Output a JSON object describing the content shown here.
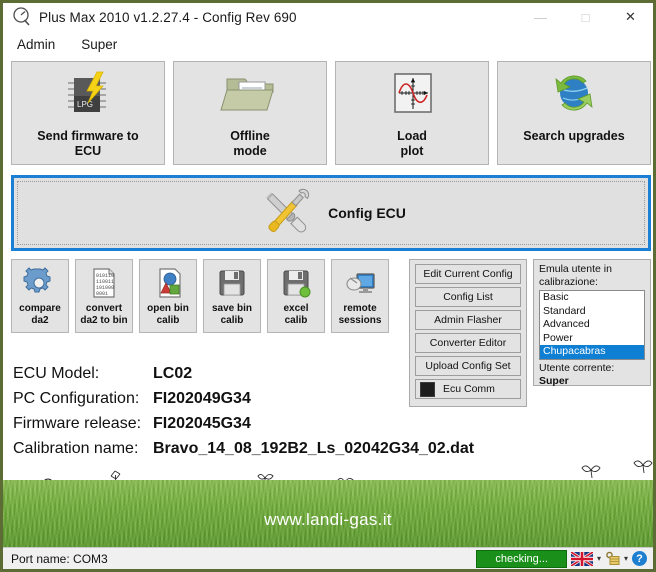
{
  "window": {
    "title": "Plus Max 2010 v1.2.27.4 - Config Rev 690",
    "app_icon": "gauge-icon",
    "minimize_label": "—",
    "maximize_label": "□",
    "close_label": "✕"
  },
  "menubar": {
    "items": [
      {
        "label": "Admin"
      },
      {
        "label": "Super"
      }
    ]
  },
  "top_buttons": [
    {
      "label": "Send firmware to ECU",
      "line1": "Send firmware to",
      "line2": "ECU",
      "icon": "lpg-chip-lightning-icon",
      "chip_text": "LPG"
    },
    {
      "label": "Offline mode",
      "line1": "Offline",
      "line2": "mode",
      "icon": "folder-document-icon"
    },
    {
      "label": "Load plot",
      "line1": "Load",
      "line2": "plot",
      "icon": "plot-graph-icon"
    },
    {
      "label": "Search upgrades",
      "line1": "Search upgrades",
      "line2": "",
      "icon": "globe-refresh-icon"
    }
  ],
  "config_banner": {
    "label": "Config ECU",
    "icon": "wrench-screwdriver-icon",
    "border_color": "#1b7fd4"
  },
  "small_buttons": [
    {
      "line1": "compare",
      "line2": "da2",
      "icon": "gear-icon"
    },
    {
      "line1": "convert",
      "line2": "da2 to bin",
      "icon": "binary-document-icon"
    },
    {
      "line1": "open bin",
      "line2": "calib",
      "icon": "shapes-document-icon"
    },
    {
      "line1": "save bin",
      "line2": "calib",
      "icon": "floppy-disk-icon"
    },
    {
      "line1": "excel",
      "line2": "calib",
      "icon": "floppy-disk-green-dot-icon"
    },
    {
      "line1": "remote",
      "line2": "sessions",
      "icon": "remote-monitor-icon"
    }
  ],
  "mid_buttons": [
    {
      "label": "Edit Current Config",
      "led": false
    },
    {
      "label": "Config List",
      "led": false
    },
    {
      "label": "Admin Flasher",
      "led": false
    },
    {
      "label": "Converter Editor",
      "led": false
    },
    {
      "label": "Upload Config Set",
      "led": false
    },
    {
      "label": "Ecu Comm",
      "led": true
    }
  ],
  "emulate_panel": {
    "title_line1": "Emula utente in",
    "title_line2": "calibrazione:",
    "options": [
      "Basic",
      "Standard",
      "Advanced",
      "Power",
      "Chupacabras"
    ],
    "selected": "Chupacabras",
    "selection_color": "#0f7fd4",
    "current_user_label": "Utente corrente:",
    "current_user": "Super"
  },
  "info": {
    "rows": [
      {
        "label": "ECU Model:",
        "value": "LC02"
      },
      {
        "label": "PC Configuration:",
        "value": "FI202049G34"
      },
      {
        "label": "Firmware release:",
        "value": "FI202045G34"
      },
      {
        "label": "Calibration name:",
        "value": "Bravo_14_08_192B2_Ls_02042G34_02.dat"
      }
    ]
  },
  "footer": {
    "site": "www.landi-gas.it"
  },
  "statusbar": {
    "port_label": "Port name: COM3",
    "checking_label": "checking...",
    "flag_icon": "uk-flag-icon",
    "flag_caret": "▾",
    "key_icon": "key-lock-icon",
    "key_caret": "▾",
    "help_icon": "help-question-icon",
    "help_label": "?"
  }
}
